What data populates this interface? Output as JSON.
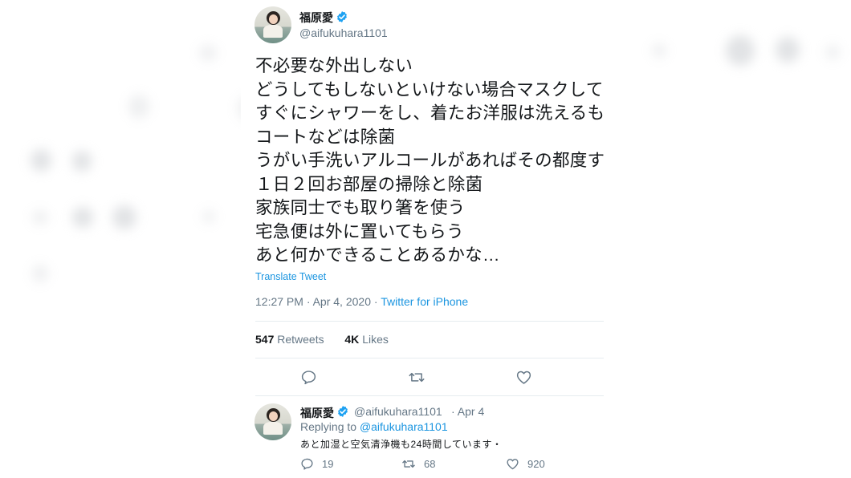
{
  "main_tweet": {
    "author_name": "福原愛",
    "author_handle": "@aifukuhara1101",
    "text_lines": [
      "不必要な外出しない",
      "どうしてもしないといけない場合マスクして",
      "すぐにシャワーをし、着たお洋服は洗えるも",
      "コートなどは除菌",
      "うがい手洗いアルコールがあればその都度す",
      "１日２回お部屋の掃除と除菌",
      "家族同士でも取り箸を使う",
      "宅急便は外に置いてもらう",
      "あと何かできることあるかな…"
    ],
    "translate_label": "Translate Tweet",
    "timestamp": "12:27 PM · Apr 4, 2020",
    "meta_separator": " · ",
    "source": "Twitter for iPhone",
    "retweets_count": "547",
    "retweets_label": "Retweets",
    "likes_count": "4K",
    "likes_label": "Likes"
  },
  "reply_tweet": {
    "author_name": "福原愛",
    "author_handle": "@aifukuhara1101",
    "date": "· Apr 4",
    "replying_prefix": "Replying to",
    "replying_handle": "@aifukuhara1101",
    "text": "あと加湿と空気清浄機も24時間しています・",
    "reply_count": "19",
    "retweet_count": "68",
    "like_count": "920"
  },
  "icons": {
    "verified": "verified-badge-icon",
    "reply": "reply-icon",
    "retweet": "retweet-icon",
    "like": "heart-icon"
  },
  "colors": {
    "link": "#1b95e0",
    "secondary_text": "#657786",
    "primary_text": "#14171a",
    "divider": "#e6ecf0"
  }
}
